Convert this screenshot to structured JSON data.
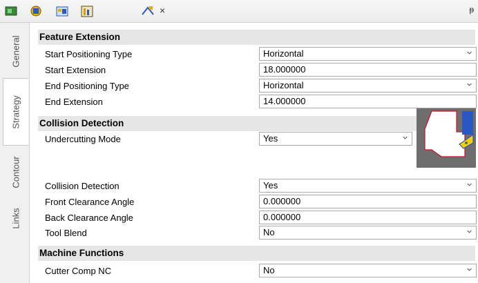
{
  "toolbar": {
    "icons": [
      "feature-tree-icon",
      "tool-icon",
      "operation-icon",
      "chart-icon",
      "toolpath-icon"
    ],
    "close_glyph": "×",
    "pin_glyph": "ᵽ"
  },
  "tabs": [
    {
      "label": "General",
      "active": false
    },
    {
      "label": "Strategy",
      "active": true
    },
    {
      "label": "Contour",
      "active": false
    },
    {
      "label": "Links",
      "active": false
    }
  ],
  "sections": {
    "feature_extension": {
      "title": "Feature Extension",
      "rows": [
        {
          "label": "Start Positioning Type",
          "value": "Horizontal",
          "kind": "select"
        },
        {
          "label": "Start Extension",
          "value": "18.000000",
          "kind": "input-pick"
        },
        {
          "label": "End Positioning Type",
          "value": "Horizontal",
          "kind": "select"
        },
        {
          "label": "End Extension",
          "value": "14.000000",
          "kind": "input-pick"
        }
      ]
    },
    "collision_detection": {
      "title": "Collision Detection",
      "rows": [
        {
          "label": "Undercutting Mode",
          "value": "Yes",
          "kind": "select"
        },
        {
          "label": "Collision Detection",
          "value": "Yes",
          "kind": "select"
        },
        {
          "label": "Front Clearance Angle",
          "value": "0.000000",
          "kind": "input"
        },
        {
          "label": "Back Clearance Angle",
          "value": "0.000000",
          "kind": "input"
        },
        {
          "label": "Tool Blend",
          "value": "No",
          "kind": "select"
        }
      ]
    },
    "machine_functions": {
      "title": "Machine Functions",
      "rows": [
        {
          "label": "Cutter Comp NC",
          "value": "No",
          "kind": "select"
        }
      ]
    }
  },
  "colors": {
    "accent": "#2a56c6",
    "tool_yellow": "#f2d000",
    "section_bg": "#e6e6e6"
  }
}
